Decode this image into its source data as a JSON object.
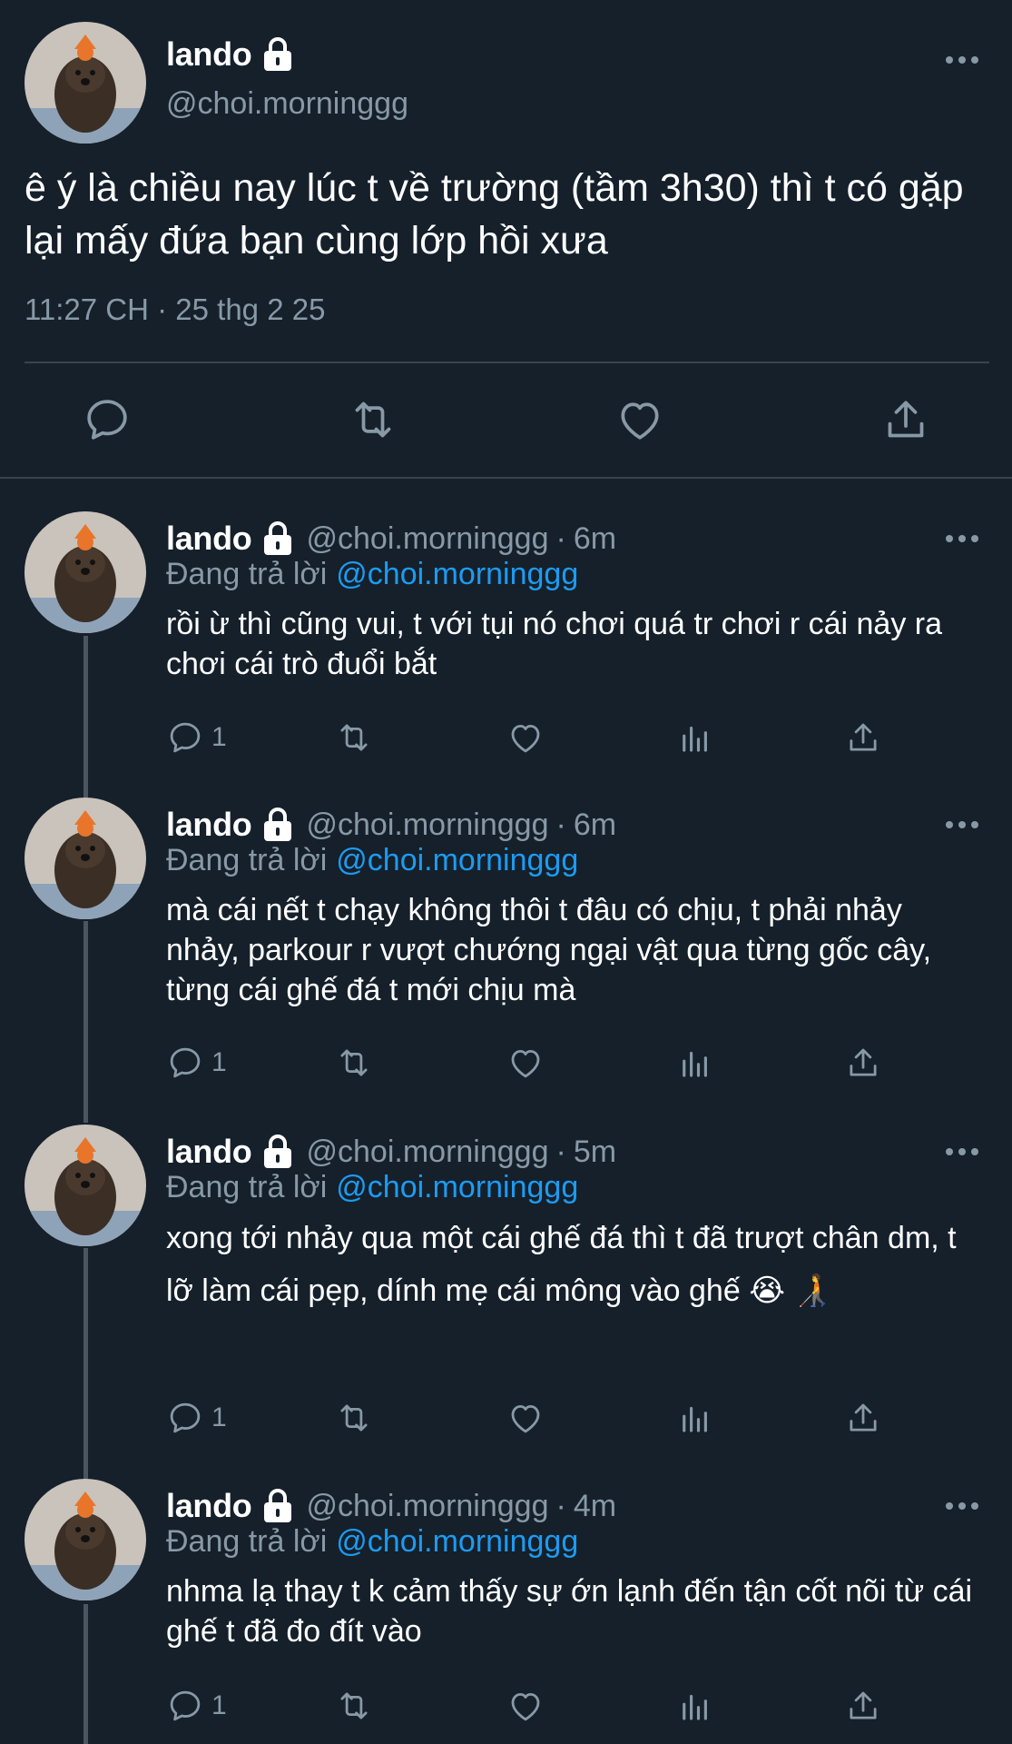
{
  "main_tweet": {
    "name": "lando",
    "handle": "@choi.morninggg",
    "text": "ê ý là chiều nay lúc t về trường (tầm 3h30) thì t có gặp lại mấy đứa bạn cùng lớp hồi xưa",
    "timestamp": "11:27 CH · 25 thg 2 25",
    "actions": [
      "reply-icon",
      "retweet-icon",
      "like-icon",
      "share-icon"
    ]
  },
  "replies": [
    {
      "name": "lando",
      "handle": "@choi.morninggg",
      "separator": "·",
      "time": "6m",
      "replying_label": "Đang trả lời",
      "replying_to": "@choi.morninggg",
      "text": "rồi ừ thì cũng vui, t với tụi nó chơi quá tr chơi r cái nảy ra chơi cái trò đuổi bắt",
      "reply_count": "1"
    },
    {
      "name": "lando",
      "handle": "@choi.morninggg",
      "separator": "·",
      "time": "6m",
      "replying_label": "Đang trả lời",
      "replying_to": "@choi.morninggg",
      "text": "mà cái nết t chạy không thôi t đâu có chịu, t phải nhảy nhảy, parkour r vượt chướng ngại vật qua từng gốc cây, từng cái ghế đá t mới chịu mà",
      "reply_count": "1"
    },
    {
      "name": "lando",
      "handle": "@choi.morninggg",
      "separator": "·",
      "time": "5m",
      "replying_label": "Đang trả lời",
      "replying_to": "@choi.morninggg",
      "text": "xong tới nhảy qua một cái ghế đá thì t đã trượt chân dm, t lỡ làm cái pẹp, dính mẹ cái mông vào ghế 😭 🧑‍🦯",
      "reply_count": "1"
    },
    {
      "name": "lando",
      "handle": "@choi.morninggg",
      "separator": "·",
      "time": "4m",
      "replying_label": "Đang trả lời",
      "replying_to": "@choi.morninggg",
      "text": "nhma lạ thay t k cảm thấy sự ớn lạnh đến tận cốt nõi từ cái ghế t đã đo đít vào",
      "reply_count": "1"
    }
  ],
  "colors": {
    "background": "#15202b",
    "text": "#ffffff",
    "secondary": "#8899a6",
    "mention": "#1d9bf0",
    "divider": "#38444d"
  }
}
